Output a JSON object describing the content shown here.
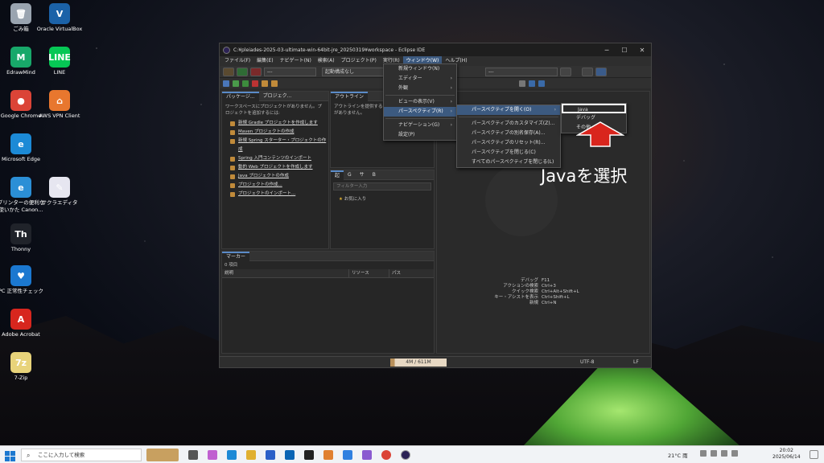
{
  "desktop": {
    "icons": [
      {
        "label": "ごみ箱",
        "name": "recycle-bin-icon",
        "color": "#9aa4b0",
        "glyph": "🗑"
      },
      {
        "label": "Oracle VirtualBox",
        "name": "virtualbox-icon",
        "color": "#1b62a8",
        "glyph": "V"
      },
      {
        "label": "EdrawMind",
        "name": "edrawmind-icon",
        "color": "#18a86a",
        "glyph": "M"
      },
      {
        "label": "LINE",
        "name": "line-icon",
        "color": "#06c755",
        "glyph": "LINE"
      },
      {
        "label": "Google Chrome",
        "name": "chrome-icon",
        "color": "#db4437",
        "glyph": "●"
      },
      {
        "label": "AWS VPN Client",
        "name": "aws-vpn-icon",
        "color": "#e8772e",
        "glyph": "⌂"
      },
      {
        "label": "Microsoft Edge",
        "name": "edge-icon",
        "color": "#1c8ad6",
        "glyph": "e"
      },
      {
        "label": "プリンターの便利な使いかた Canon...",
        "name": "canon-icon",
        "color": "#2b8fd6",
        "glyph": "e"
      },
      {
        "label": "サクラエディタ",
        "name": "sakura-editor-icon",
        "color": "#e6e6f0",
        "glyph": "✎"
      },
      {
        "label": "Thonny",
        "name": "thonny-icon",
        "color": "#20232a",
        "glyph": "Th"
      },
      {
        "label": "PC 正常性チェック",
        "name": "pc-health-icon",
        "color": "#1b78d0",
        "glyph": "♥"
      },
      {
        "label": "Adobe Acrobat",
        "name": "acrobat-icon",
        "color": "#d7261e",
        "glyph": "A"
      },
      {
        "label": "7-Zip",
        "name": "zip-icon",
        "color": "#e8d37a",
        "glyph": "7z"
      }
    ]
  },
  "window": {
    "title": "C:¥pleiades-2025-03-ultimate-win-64bit-jre_20250319¥workspace - Eclipse IDE",
    "minimize": "─",
    "maximize": "☐",
    "close": "✕",
    "menu": [
      "ファイル(F)",
      "編集(E)",
      "ナビゲート(N)",
      "検索(A)",
      "プロジェクト(P)",
      "実行(R)",
      "ウィンドウ(W)",
      "ヘルプ(H)"
    ],
    "combo1": "---",
    "combo2": "起動構成なし",
    "combo3": "---"
  },
  "package_explorer": {
    "tab1": "パッケージ...",
    "tab2": "プロジェク...",
    "message": "ワークスペースにプロジェクトがありません。プロジェクトを追加するには:",
    "links": [
      "新規 Gradle プロジェクトを作成します",
      "Maven プロジェクトの作成",
      "新規 Spring スターター・プロジェクトの作成",
      "Spring 入門コンテンツのインポート",
      "動的 Web プロジェクトを作成します",
      "Java プロジェクトの作成",
      "プロジェクトの作成...",
      "プロジェクトのインポート..."
    ]
  },
  "outline": {
    "tab": "アウトライン",
    "message": "アウトラインを提供するアクティブなエディターがありません。"
  },
  "bottom_mid": {
    "tabs": [
      "起",
      "G",
      "サ",
      "B"
    ],
    "filter": "フィルター入力",
    "favorite": "お気に入り"
  },
  "markers": {
    "tab": "マーカー",
    "count": "0 項目",
    "columns": [
      "説明",
      "リソース",
      "パス"
    ]
  },
  "editor_hints": [
    {
      "label": "デバッグ",
      "key": "F11"
    },
    {
      "label": "アクションの検索",
      "key": "Ctrl+3"
    },
    {
      "label": "クイック検索",
      "key": "Ctrl+Alt+Shift+L"
    },
    {
      "label": "キー・アシストを表示",
      "key": "Ctrl+Shift+L"
    },
    {
      "label": "新規",
      "key": "Ctrl+N"
    }
  ],
  "status": {
    "memory": "4M / 611M",
    "encoding": "UTF-8",
    "line_ending": "LF"
  },
  "window_menu": {
    "items": [
      {
        "label": "新規ウィンドウ(N)",
        "arrow": ""
      },
      {
        "label": "エディター",
        "arrow": "›"
      },
      {
        "label": "外観",
        "arrow": "›"
      },
      {
        "label": "ビューの表示(V)",
        "arrow": "›"
      },
      {
        "label": "パースペクティブ(R)",
        "arrow": "›"
      },
      {
        "label": "ナビゲーション(G)",
        "arrow": "›"
      },
      {
        "label": "設定(P)",
        "arrow": ""
      }
    ]
  },
  "perspective_menu": {
    "items": [
      "パースペクティブを開く(O)",
      "パースペクティブのカスタマイズ(Z)...",
      "パースペクティブの別名保存(A)...",
      "パースペクティブのリセット(R)...",
      "パースペクティブを閉じる(C)",
      "すべてのパースペクティブを閉じる(L)"
    ]
  },
  "open_perspective_menu": {
    "items": [
      "Java",
      "デバッグ",
      "その他..."
    ]
  },
  "annotation": {
    "text": "Javaを選択",
    "arrow_color": "#d9251d"
  },
  "taskbar": {
    "search_placeholder": "ここに入力して検索",
    "weather": "21°C 雨",
    "time": "20:02",
    "date": "2025/06/14"
  }
}
